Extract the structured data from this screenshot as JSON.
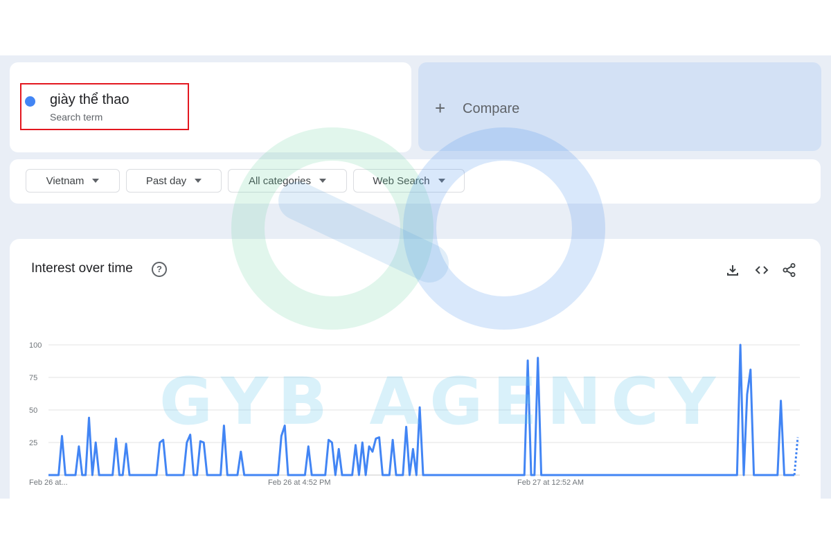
{
  "search_term": {
    "label": "giày thể thao",
    "sublabel": "Search term",
    "color": "#4285f4"
  },
  "compare": {
    "plus": "+",
    "label": "Compare"
  },
  "filters": [
    {
      "label": "Vietnam"
    },
    {
      "label": "Past day"
    },
    {
      "label": "All categories"
    },
    {
      "label": "Web Search"
    }
  ],
  "chart_panel": {
    "title": "Interest over time",
    "help_icon": "help-circle-icon",
    "tools": [
      "download-icon",
      "embed-code-icon",
      "share-icon"
    ]
  },
  "watermark": {
    "text": "GYB AGENCY"
  },
  "chart_data": {
    "type": "line",
    "title": "",
    "ylim": [
      0,
      100
    ],
    "y_ticks": [
      100,
      75,
      50,
      25
    ],
    "x_tick_labels": [
      "Feb 26 at...",
      "Feb 26 at 4:52 PM",
      "Feb 27 at 12:52 AM"
    ],
    "grid": true,
    "series": [
      {
        "color": "#4285f4",
        "values": [
          0,
          0,
          0,
          0,
          30,
          0,
          0,
          0,
          0,
          22,
          0,
          0,
          44,
          0,
          25,
          0,
          0,
          0,
          0,
          0,
          28,
          0,
          0,
          24,
          0,
          0,
          0,
          0,
          0,
          0,
          0,
          0,
          0,
          25,
          27,
          0,
          0,
          0,
          0,
          0,
          0,
          25,
          31,
          0,
          0,
          26,
          25,
          0,
          0,
          0,
          0,
          0,
          38,
          0,
          0,
          0,
          0,
          18,
          0,
          0,
          0,
          0,
          0,
          0,
          0,
          0,
          0,
          0,
          0,
          30,
          38,
          0,
          0,
          0,
          0,
          0,
          0,
          22,
          0,
          0,
          0,
          0,
          0,
          27,
          25,
          0,
          20,
          0,
          0,
          0,
          0,
          23,
          0,
          25,
          0,
          22,
          18,
          28,
          29,
          0,
          0,
          0,
          27,
          0,
          0,
          0,
          37,
          0,
          20,
          0,
          52,
          0,
          0,
          0,
          0,
          0,
          0,
          0,
          0,
          0,
          0,
          0,
          0,
          0,
          0,
          0,
          0,
          0,
          0,
          0,
          0,
          0,
          0,
          0,
          0,
          0,
          0,
          0,
          0,
          0,
          0,
          0,
          88,
          0,
          0,
          90,
          0,
          0,
          0,
          0,
          0,
          0,
          0,
          0,
          0,
          0,
          0,
          0,
          0,
          0,
          0,
          0,
          0,
          0,
          0,
          0,
          0,
          0,
          0,
          0,
          0,
          0,
          0,
          0,
          0,
          0,
          0,
          0,
          0,
          0,
          0,
          0,
          0,
          0,
          0,
          0,
          0,
          0,
          0,
          0,
          0,
          0,
          0,
          0,
          0,
          0,
          0,
          0,
          0,
          0,
          0,
          0,
          0,
          0,
          0,
          100,
          0,
          62,
          81,
          0,
          0,
          0,
          0,
          0,
          0,
          0,
          0,
          57,
          0,
          0,
          0,
          0,
          29
        ],
        "partial_last": true
      }
    ]
  }
}
